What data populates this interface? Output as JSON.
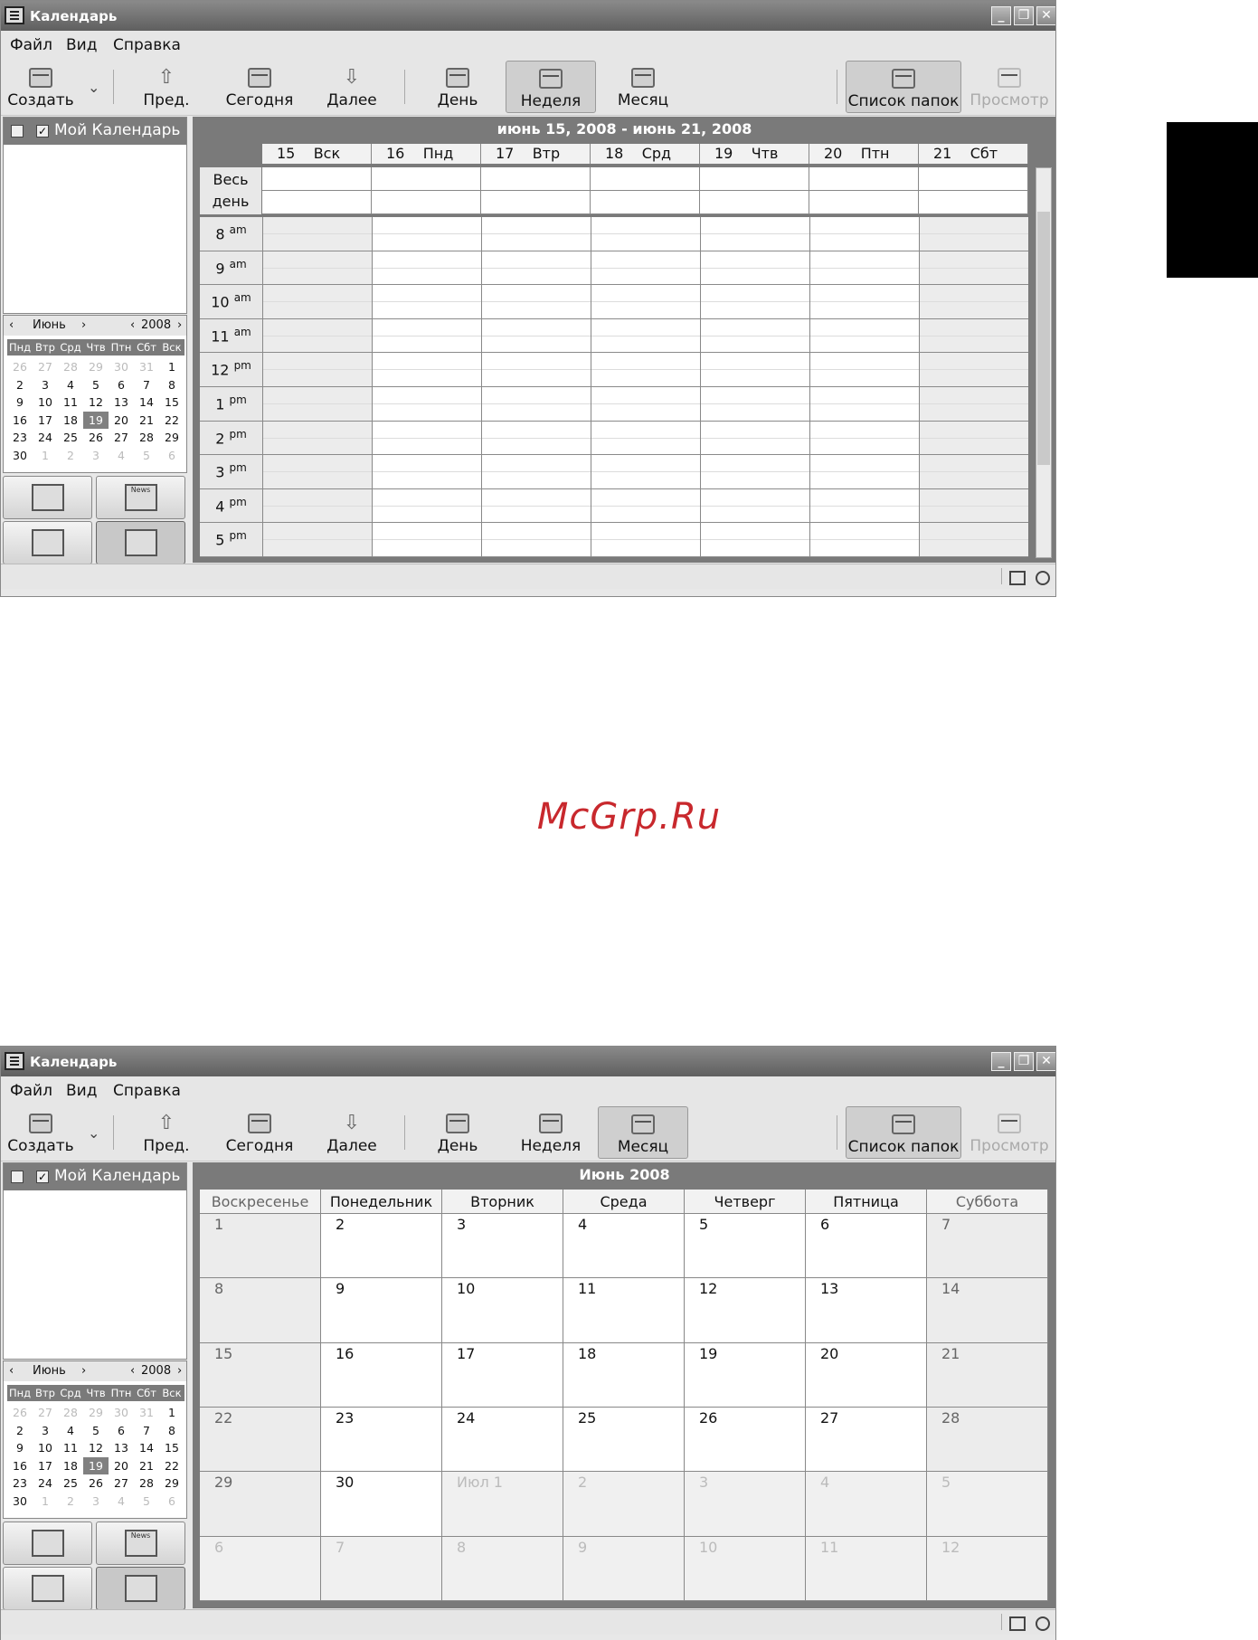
{
  "window1": {
    "title": "Календарь",
    "menu": [
      "Файл",
      "Вид",
      "Справка"
    ],
    "toolbar": {
      "create": "Создать",
      "prev": "Пред.",
      "today": "Сегодня",
      "next": "Далее",
      "day": "День",
      "week": "Неделя",
      "month": "Месяц",
      "folders": "Список папок",
      "preview": "Просмотр"
    },
    "active_view": "week",
    "calendar_name": "Мой Календарь",
    "mini_calendar": {
      "month": "Июнь",
      "year": "2008",
      "weekdays": [
        "Пнд",
        "Втр",
        "Срд",
        "Чтв",
        "Птн",
        "Сбт",
        "Вск"
      ],
      "days": [
        "26",
        "27",
        "28",
        "29",
        "30",
        "31",
        "1",
        "2",
        "3",
        "4",
        "5",
        "6",
        "7",
        "8",
        "9",
        "10",
        "11",
        "12",
        "13",
        "14",
        "15",
        "16",
        "17",
        "18",
        "19",
        "20",
        "21",
        "22",
        "23",
        "24",
        "25",
        "26",
        "27",
        "28",
        "29",
        "30",
        "1",
        "2",
        "3",
        "4",
        "5",
        "6"
      ],
      "today": "19"
    },
    "week_title": "июнь 15, 2008 - июнь 21, 2008",
    "week_days": [
      {
        "num": "15",
        "name": "Вск"
      },
      {
        "num": "16",
        "name": "Пнд"
      },
      {
        "num": "17",
        "name": "Втр"
      },
      {
        "num": "18",
        "name": "Срд"
      },
      {
        "num": "19",
        "name": "Чтв"
      },
      {
        "num": "20",
        "name": "Птн"
      },
      {
        "num": "21",
        "name": "Сбт"
      }
    ],
    "allday_label": "Весь день",
    "hours": [
      {
        "h": "8",
        "p": "am"
      },
      {
        "h": "9",
        "p": "am"
      },
      {
        "h": "10",
        "p": "am"
      },
      {
        "h": "11",
        "p": "am"
      },
      {
        "h": "12",
        "p": "pm"
      },
      {
        "h": "1",
        "p": "pm"
      },
      {
        "h": "2",
        "p": "pm"
      },
      {
        "h": "3",
        "p": "pm"
      },
      {
        "h": "4",
        "p": "pm"
      },
      {
        "h": "5",
        "p": "pm"
      }
    ]
  },
  "window2": {
    "title": "Календарь",
    "menu": [
      "Файл",
      "Вид",
      "Справка"
    ],
    "toolbar": {
      "create": "Создать",
      "prev": "Пред.",
      "today": "Сегодня",
      "next": "Далее",
      "day": "День",
      "week": "Неделя",
      "month": "Месяц",
      "folders": "Список папок",
      "preview": "Просмотр"
    },
    "active_view": "month",
    "calendar_name": "Мой Календарь",
    "mini_calendar": {
      "month": "Июнь",
      "year": "2008",
      "weekdays": [
        "Пнд",
        "Втр",
        "Срд",
        "Чтв",
        "Птн",
        "Сбт",
        "Вск"
      ],
      "days": [
        "26",
        "27",
        "28",
        "29",
        "30",
        "31",
        "1",
        "2",
        "3",
        "4",
        "5",
        "6",
        "7",
        "8",
        "9",
        "10",
        "11",
        "12",
        "13",
        "14",
        "15",
        "16",
        "17",
        "18",
        "19",
        "20",
        "21",
        "22",
        "23",
        "24",
        "25",
        "26",
        "27",
        "28",
        "29",
        "30",
        "1",
        "2",
        "3",
        "4",
        "5",
        "6"
      ],
      "today": "19"
    },
    "month_title": "Июнь   2008",
    "month_weekdays": [
      "Воскресенье",
      "Понедельник",
      "Вторник",
      "Среда",
      "Четверг",
      "Пятница",
      "Суббота"
    ],
    "month_days": [
      "1",
      "2",
      "3",
      "4",
      "5",
      "6",
      "7",
      "8",
      "9",
      "10",
      "11",
      "12",
      "13",
      "14",
      "15",
      "16",
      "17",
      "18",
      "19",
      "20",
      "21",
      "22",
      "23",
      "24",
      "25",
      "26",
      "27",
      "28",
      "29",
      "30",
      "Июл  1",
      "2",
      "3",
      "4",
      "5",
      "6",
      "7",
      "8",
      "9",
      "10",
      "11",
      "12"
    ]
  },
  "watermark": "McGrp.Ru",
  "app_buttons": {
    "news_label": "News"
  }
}
